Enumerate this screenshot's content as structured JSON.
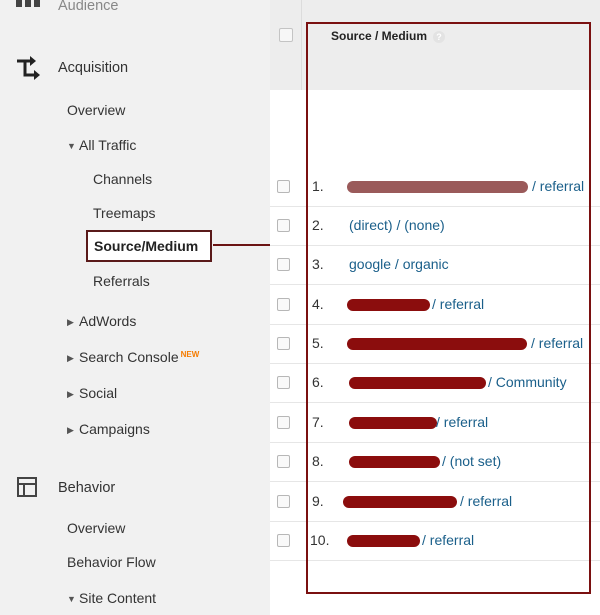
{
  "sidebar": {
    "audience": "Audience",
    "acquisition": "Acquisition",
    "overview": "Overview",
    "all_traffic": "All Traffic",
    "channels": "Channels",
    "treemaps": "Treemaps",
    "source_medium": "Source/Medium",
    "referrals": "Referrals",
    "adwords": "AdWords",
    "search_console": "Search Console",
    "new_badge": "NEW",
    "social": "Social",
    "campaigns": "Campaigns",
    "behavior": "Behavior",
    "behavior_overview": "Overview",
    "behavior_flow": "Behavior Flow",
    "site_content": "Site Content"
  },
  "table": {
    "header": "Source / Medium",
    "help": "?",
    "rows": [
      {
        "num": "1.",
        "text": "/ referral"
      },
      {
        "num": "2.",
        "text": "(direct) / (none)"
      },
      {
        "num": "3.",
        "text": "google / organic"
      },
      {
        "num": "4.",
        "text": "/ referral"
      },
      {
        "num": "5.",
        "text": "/ referral"
      },
      {
        "num": "6.",
        "text": "/ Community"
      },
      {
        "num": "7.",
        "text": "/ referral"
      },
      {
        "num": "8.",
        "text": "/ (not set)"
      },
      {
        "num": "9.",
        "text": "/ referral"
      },
      {
        "num": "10.",
        "text": "/ referral"
      }
    ]
  },
  "colors": {
    "highlight_border": "#7a1010",
    "link_text": "#1a5f8a",
    "redaction": "#8b0d0d",
    "new_badge": "#f57c00"
  }
}
